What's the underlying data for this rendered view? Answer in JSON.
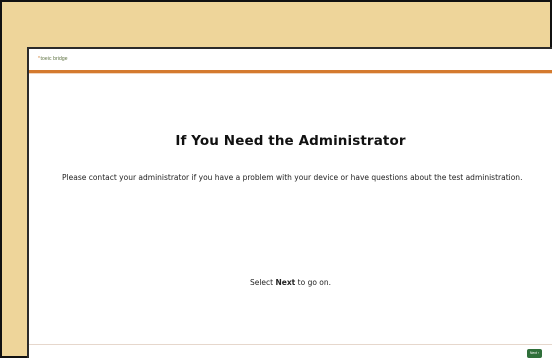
{
  "brand": {
    "logo_mark": "*",
    "name": "toeic bridge"
  },
  "page": {
    "title": "If You Need the Administrator",
    "body": "Please contact your administrator if you have a problem with your device or have questions about the test administration.",
    "instruction_prefix": "Select ",
    "instruction_bold": "Next",
    "instruction_suffix": " to go on."
  },
  "footer": {
    "next_label": "Next",
    "next_arrow": "›"
  },
  "colors": {
    "frame_bg": "#eed59a",
    "accent": "#d47a2e",
    "button": "#2f6f3a",
    "brand_text": "#5a6e3c"
  },
  "icons": {
    "logo": "brand-logo-icon",
    "next_arrow": "chevron-right-icon"
  }
}
